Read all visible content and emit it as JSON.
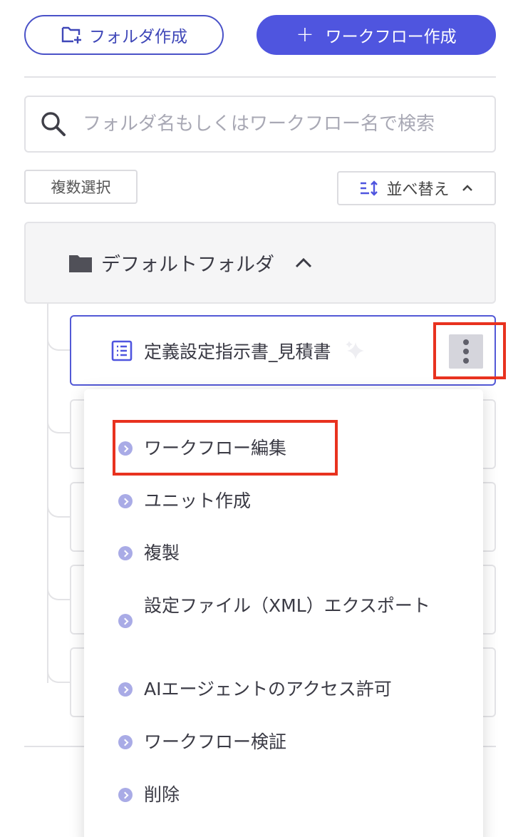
{
  "toolbar": {
    "create_folder_label": "フォルダ作成",
    "create_workflow_label": "ワークフロー作成",
    "plus_symbol": "+"
  },
  "search": {
    "placeholder": "フォルダ名もしくはワークフロー名で検索",
    "value": ""
  },
  "controls": {
    "multi_select_label": "複数選択",
    "sort_label": "並べ替え"
  },
  "folder": {
    "name": "デフォルトフォルダ",
    "expanded": true
  },
  "workflow_item": {
    "name": "定義設定指示書_見積書"
  },
  "context_menu": {
    "items": [
      {
        "label": "ワークフロー編集"
      },
      {
        "label": "ユニット作成"
      },
      {
        "label": "複製"
      },
      {
        "label": "設定ファイル（XML）エクスポート"
      },
      {
        "label": "AIエージェントのアクセス許可"
      },
      {
        "label": "ワークフロー検証"
      },
      {
        "label": "削除"
      }
    ]
  },
  "colors": {
    "primary": "#4f55df",
    "primary_border": "#4a52c8",
    "highlight_red": "#e8321f",
    "bullet": "#a9abe6"
  },
  "icons": {
    "folder_add": "folder-add-icon",
    "search": "search-icon",
    "sort": "sort-icon",
    "chevron_up": "chevron-up-icon",
    "folder": "folder-icon",
    "document_list": "document-list-icon",
    "sparkle": "sparkle-icon",
    "more_vertical": "more-vertical-icon",
    "chevron_circle_right": "chevron-circle-right-icon"
  }
}
